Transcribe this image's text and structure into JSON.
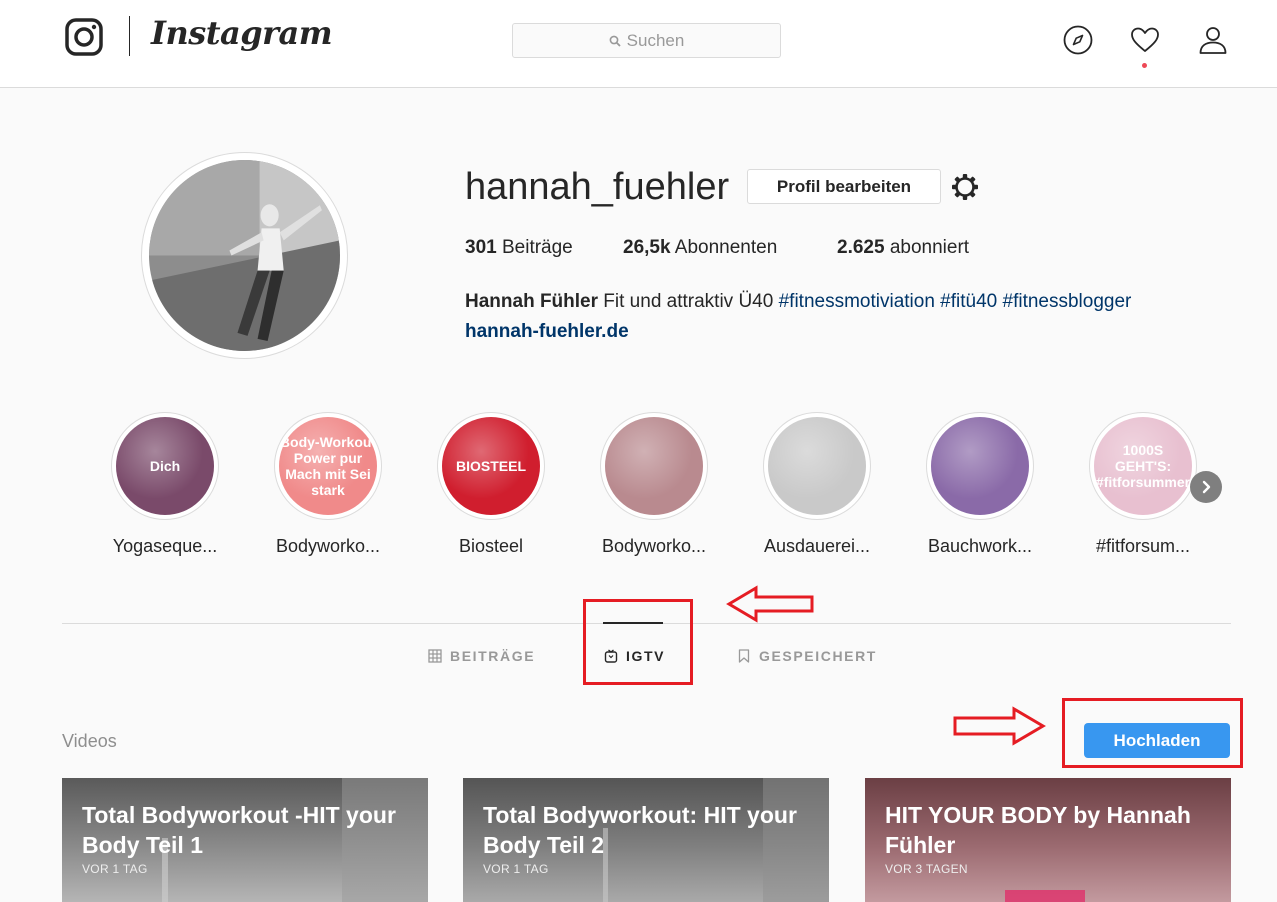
{
  "nav": {
    "brand": "Instagram",
    "search_placeholder": "Suchen"
  },
  "profile": {
    "username": "hannah_fuehler",
    "edit_label": "Profil bearbeiten",
    "stats": [
      {
        "value": "301",
        "label": "Beiträge"
      },
      {
        "value": "26,5k",
        "label": "Abonnenten"
      },
      {
        "value": "2.625",
        "label": "abonniert"
      }
    ],
    "bio_name": "Hannah Fühler",
    "bio_text": "Fit und attraktiv Ü40",
    "bio_tags": "#fitnessmotiviation #fitü40 #fitnessblogger",
    "bio_link": "hannah-fuehler.de"
  },
  "highlights": [
    {
      "label": "Yogaseque...",
      "overlay": "Dich",
      "color": "#7a4a6a"
    },
    {
      "label": "Bodyworko...",
      "overlay": "Body-Workout Power pur Mach mit Sei stark",
      "color": "#f08a8a"
    },
    {
      "label": "Biosteel",
      "overlay": "BIOSTEEL",
      "color": "#d01e2e"
    },
    {
      "label": "Bodyworko...",
      "overlay": "",
      "color": "#b98a8f"
    },
    {
      "label": "Ausdauerei...",
      "overlay": "",
      "color": "#c9c9c9"
    },
    {
      "label": "Bauchwork...",
      "overlay": "",
      "color": "#8a6aa8"
    },
    {
      "label": "#fitforsum...",
      "overlay": "1000S GEHT'S: #fitforsummer",
      "color": "#e8c0d0"
    }
  ],
  "tabs": [
    {
      "label": "BEITRÄGE",
      "icon": "grid-icon"
    },
    {
      "label": "IGTV",
      "icon": "igtv-icon"
    },
    {
      "label": "GESPEICHERT",
      "icon": "bookmark-icon"
    }
  ],
  "videos_section": {
    "title": "Videos",
    "upload_label": "Hochladen"
  },
  "videos": [
    {
      "title": "Total Bodyworkout -HIT your Body Teil 1",
      "age": "VOR 1 TAG"
    },
    {
      "title": "Total Bodyworkout: HIT your Body Teil 2",
      "age": "VOR 1 TAG"
    },
    {
      "title": "HIT YOUR BODY by Hannah Fühler",
      "age": "VOR 3 TAGEN"
    }
  ],
  "colors": {
    "accent": "#3897f0",
    "link": "#003569",
    "annotation": "#e51c23"
  }
}
